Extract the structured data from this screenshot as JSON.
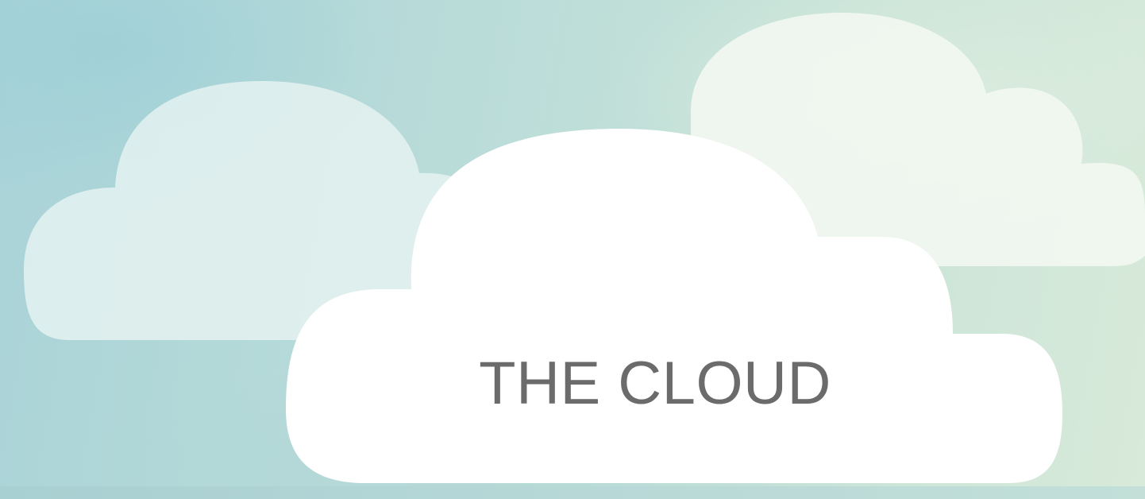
{
  "cloud_label": "THE CLOUD",
  "colors": {
    "sky_left": "#a9d3d8",
    "sky_right": "#d8ead9",
    "label_text": "#6b6b6b",
    "cloud_front": "#ffffff"
  }
}
